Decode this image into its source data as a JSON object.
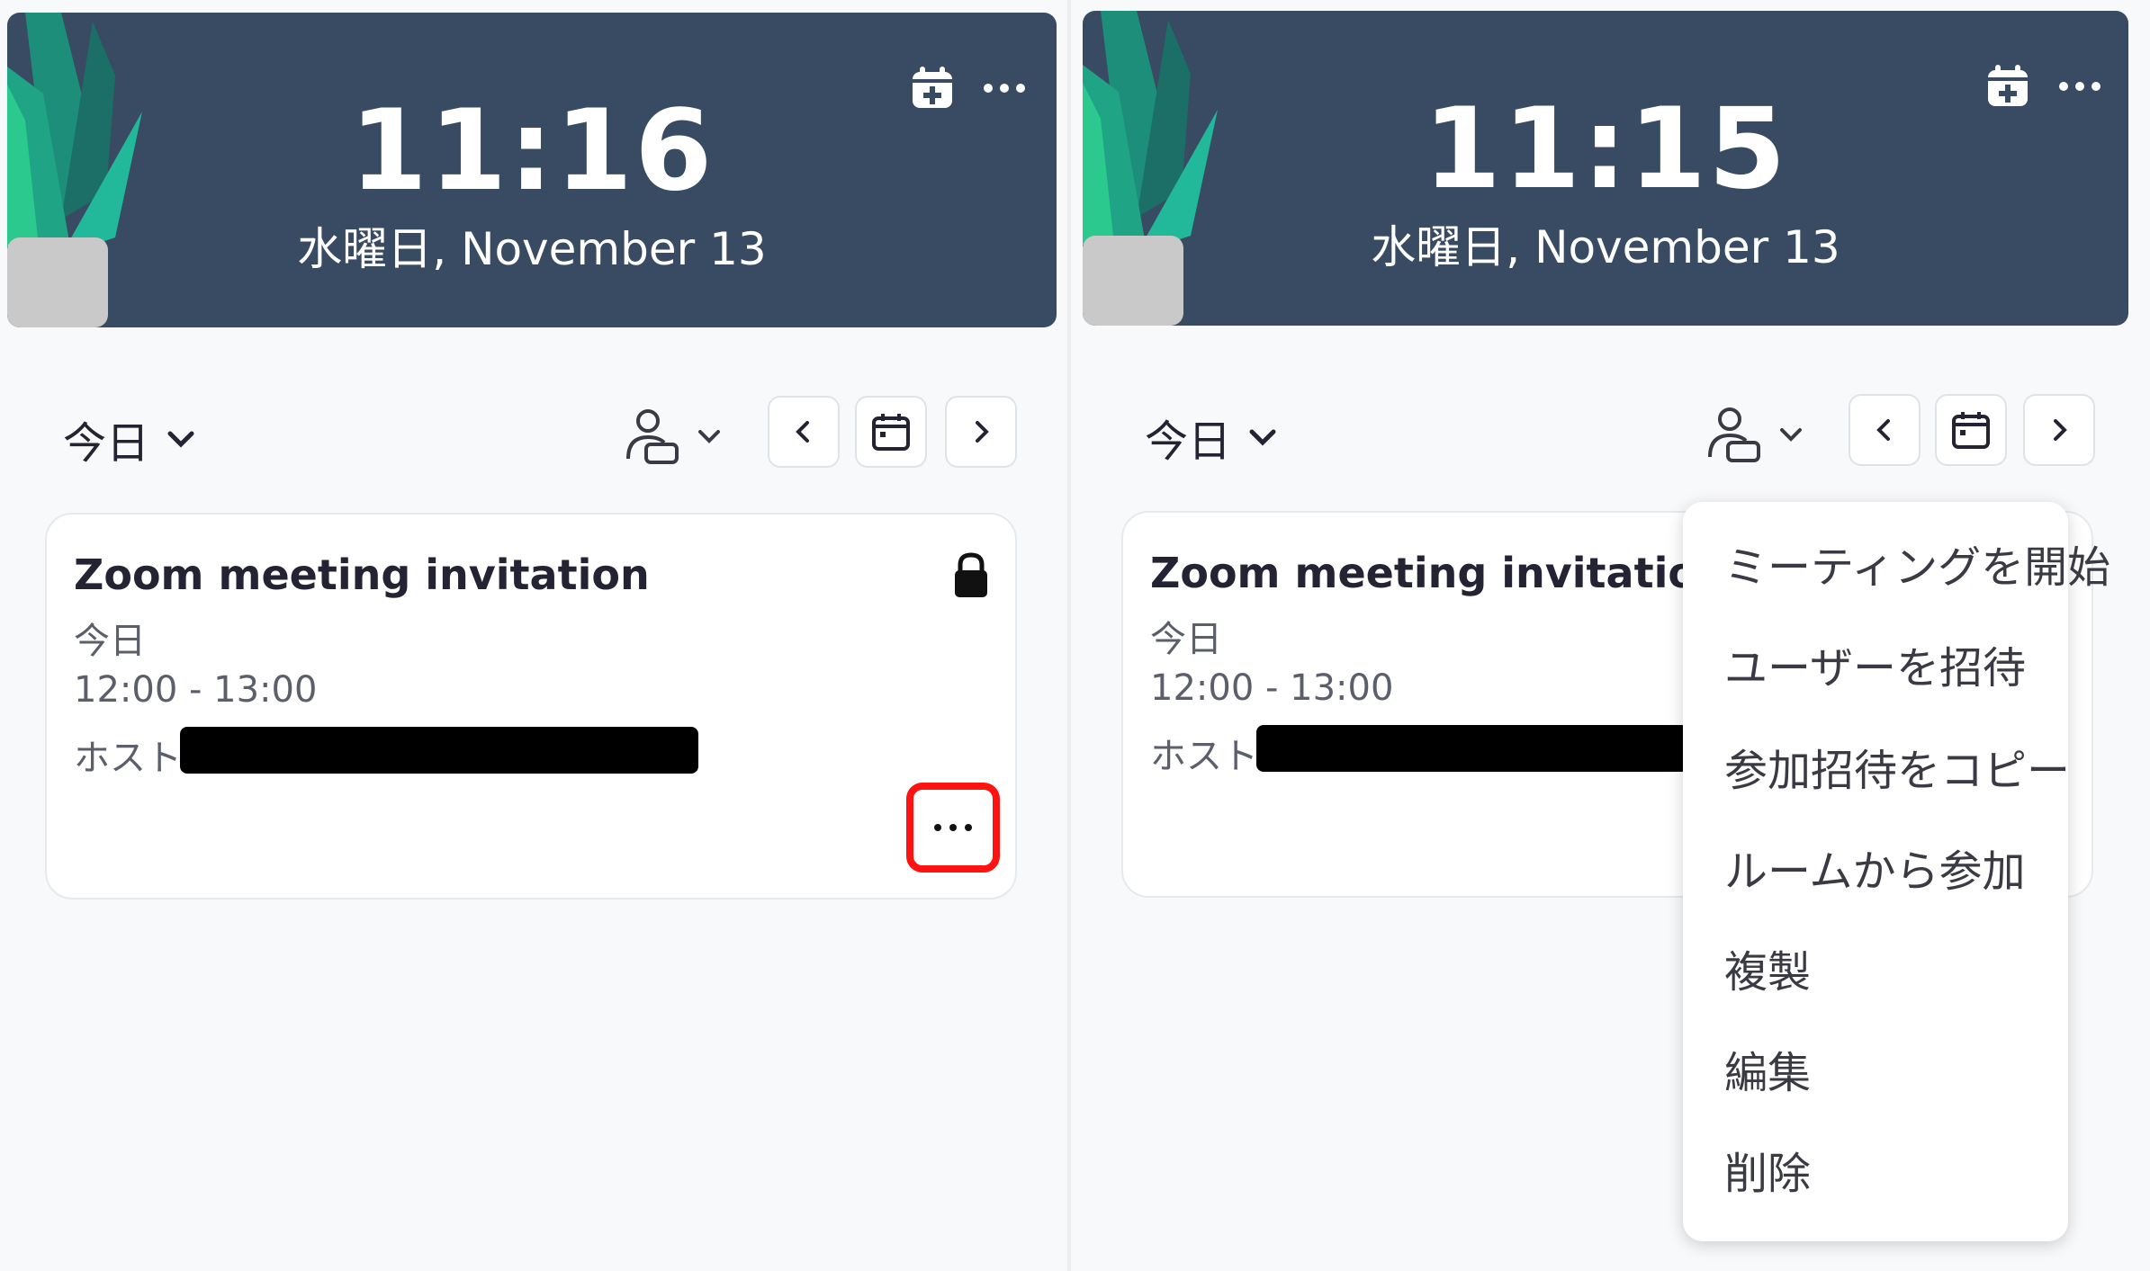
{
  "left": {
    "clock": "11:16",
    "date": "水曜日, November 13",
    "today_label": "今日",
    "meeting": {
      "title": "Zoom meeting invitation",
      "day": "今日",
      "time": "12:00 - 13:00",
      "host_label": "ホスト:"
    }
  },
  "right": {
    "clock": "11:15",
    "date": "水曜日, November 13",
    "today_label": "今日",
    "meeting": {
      "title": "Zoom meeting invitation",
      "day": "今日",
      "time": "12:00 - 13:00",
      "host_label": "ホスト:"
    },
    "menu_items": [
      "ミーティングを開始",
      "ユーザーを招待",
      "参加招待をコピー",
      "ルームから参加",
      "複製",
      "編集",
      "削除"
    ]
  },
  "colors": {
    "header_bg": "#384b62",
    "highlight": "#ff1212",
    "plant_dark": "#1c7a6a",
    "plant_light": "#22b89a"
  }
}
